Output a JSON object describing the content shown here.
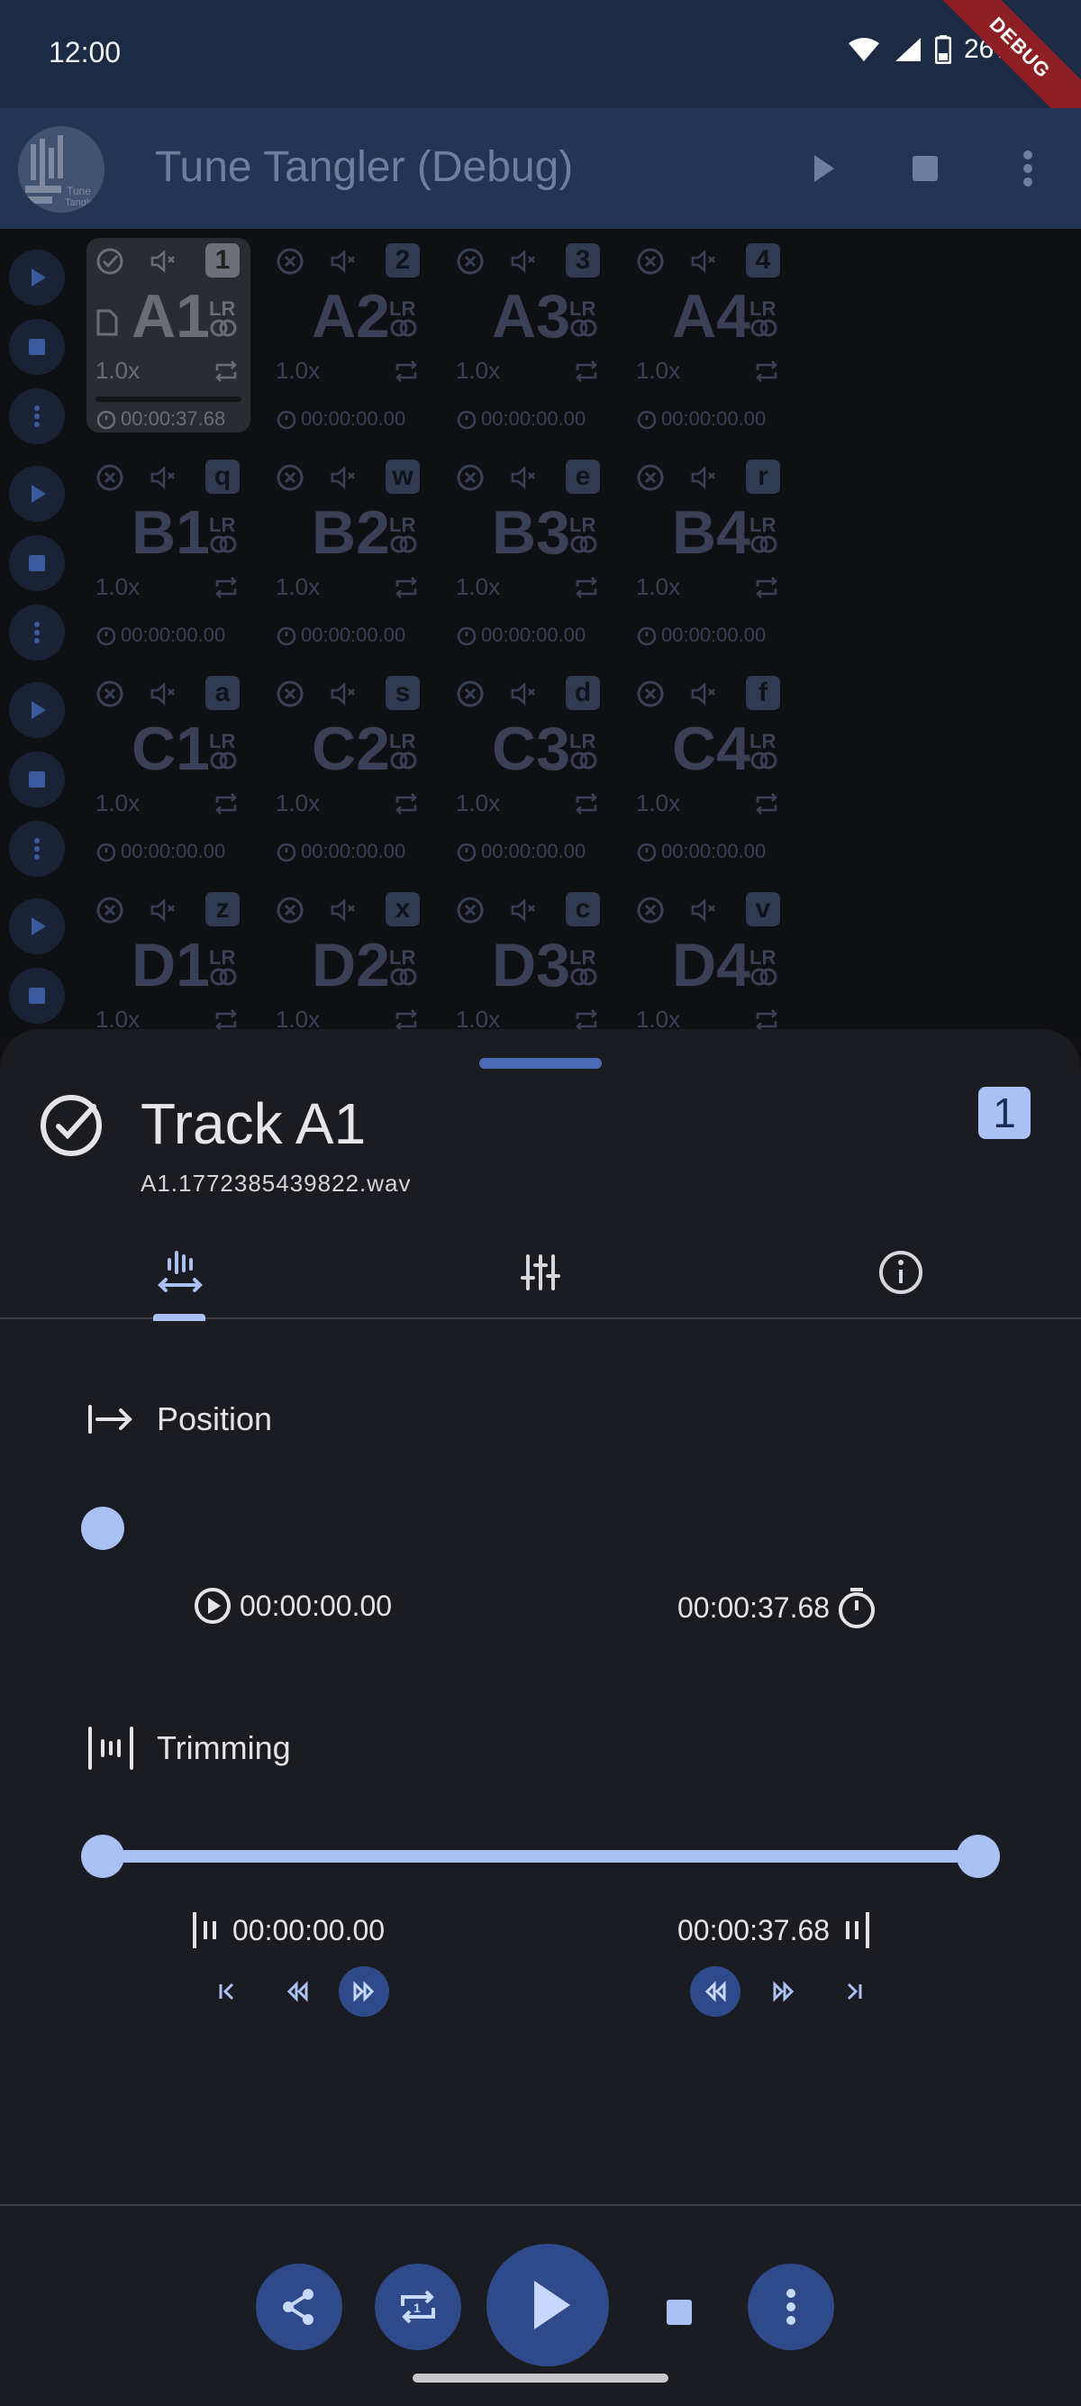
{
  "status_bar": {
    "time": "12:00",
    "battery": "26%",
    "debug_label": "DEBUG"
  },
  "app_bar": {
    "title": "Tune Tangler (Debug)",
    "logo_text": "Tune Tangler"
  },
  "grid": {
    "rows": [
      {
        "pads": [
          {
            "id": "A1",
            "key": "1",
            "speed": "1.0x",
            "duration": "00:00:37.68",
            "lr": "LR",
            "selected": true
          },
          {
            "id": "A2",
            "key": "2",
            "speed": "1.0x",
            "duration": "00:00:00.00",
            "lr": "LR"
          },
          {
            "id": "A3",
            "key": "3",
            "speed": "1.0x",
            "duration": "00:00:00.00",
            "lr": "LR"
          },
          {
            "id": "A4",
            "key": "4",
            "speed": "1.0x",
            "duration": "00:00:00.00",
            "lr": "LR"
          }
        ]
      },
      {
        "pads": [
          {
            "id": "B1",
            "key": "q",
            "speed": "1.0x",
            "duration": "00:00:00.00",
            "lr": "LR"
          },
          {
            "id": "B2",
            "key": "w",
            "speed": "1.0x",
            "duration": "00:00:00.00",
            "lr": "LR"
          },
          {
            "id": "B3",
            "key": "e",
            "speed": "1.0x",
            "duration": "00:00:00.00",
            "lr": "LR"
          },
          {
            "id": "B4",
            "key": "r",
            "speed": "1.0x",
            "duration": "00:00:00.00",
            "lr": "LR"
          }
        ]
      },
      {
        "pads": [
          {
            "id": "C1",
            "key": "a",
            "speed": "1.0x",
            "duration": "00:00:00.00",
            "lr": "LR"
          },
          {
            "id": "C2",
            "key": "s",
            "speed": "1.0x",
            "duration": "00:00:00.00",
            "lr": "LR"
          },
          {
            "id": "C3",
            "key": "d",
            "speed": "1.0x",
            "duration": "00:00:00.00",
            "lr": "LR"
          },
          {
            "id": "C4",
            "key": "f",
            "speed": "1.0x",
            "duration": "00:00:00.00",
            "lr": "LR"
          }
        ]
      },
      {
        "pads": [
          {
            "id": "D1",
            "key": "z",
            "speed": "1.0x",
            "duration": "",
            "lr": "LR"
          },
          {
            "id": "D2",
            "key": "x",
            "speed": "1.0x",
            "duration": "",
            "lr": "LR"
          },
          {
            "id": "D3",
            "key": "c",
            "speed": "1.0x",
            "duration": "",
            "lr": "LR"
          },
          {
            "id": "D4",
            "key": "v",
            "speed": "1.0x",
            "duration": "",
            "lr": "LR"
          }
        ]
      }
    ]
  },
  "sheet": {
    "title": "Track A1",
    "filename": "A1.1772385439822.wav",
    "key": "1",
    "tabs": [
      "position-trim-tab",
      "mixer-tab",
      "info-tab"
    ],
    "position": {
      "label": "Position",
      "value_fraction": 0.0,
      "current": "00:00:00.00",
      "total": "00:00:37.68"
    },
    "trimming": {
      "label": "Trimming",
      "start_fraction": 0.0,
      "end_fraction": 1.0,
      "start": "00:00:00.00",
      "end": "00:00:37.68"
    }
  },
  "colors": {
    "accent": "#a9c1f5",
    "button": "#2f4a8a",
    "sheet_bg": "#1b1c21",
    "appbar": "#233554"
  }
}
